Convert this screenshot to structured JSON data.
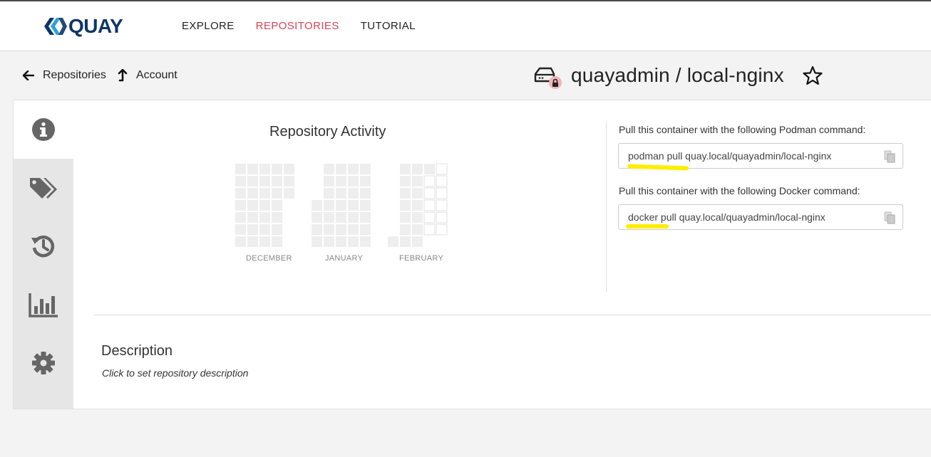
{
  "app": {
    "logo_text": "QUAY",
    "brand_color": "#0e3567",
    "accent_color": "#d64456"
  },
  "nav": {
    "items": [
      {
        "label": "EXPLORE",
        "active": false
      },
      {
        "label": "REPOSITORIES",
        "active": true
      },
      {
        "label": "TUTORIAL",
        "active": false
      }
    ]
  },
  "breadcrumb": {
    "back_label": "Repositories",
    "up_label": "Account"
  },
  "repo": {
    "title": "quayadmin / local-nginx",
    "private": true,
    "starred": false
  },
  "sidebar": {
    "tabs": [
      {
        "icon": "info-icon",
        "active": true
      },
      {
        "icon": "tags-icon",
        "active": false
      },
      {
        "icon": "history-icon",
        "active": false
      },
      {
        "icon": "usage-logs-icon",
        "active": false
      },
      {
        "icon": "settings-icon",
        "active": false
      }
    ]
  },
  "activity": {
    "title": "Repository Activity",
    "months": [
      "DECEMBER",
      "JANUARY",
      "FEBRUARY"
    ]
  },
  "pull": {
    "podman_label": "Pull this container with the following Podman command:",
    "podman_cmd": "podman pull quay.local/quayadmin/local-nginx",
    "docker_label": "Pull this container with the following Docker command:",
    "docker_cmd": "docker pull quay.local/quayadmin/local-nginx",
    "highlight_color": "#ffee00"
  },
  "description": {
    "title": "Description",
    "placeholder": "Click to set repository description"
  }
}
